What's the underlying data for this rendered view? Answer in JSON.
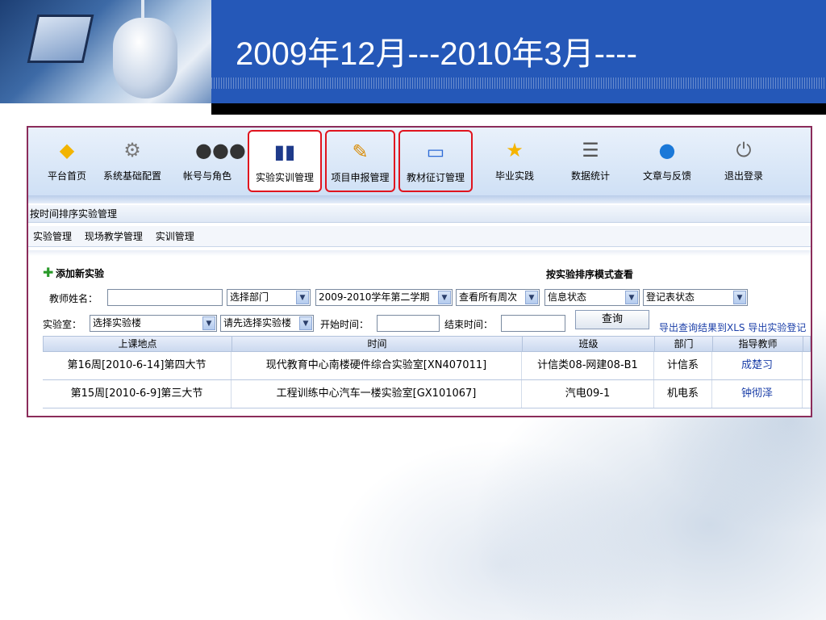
{
  "slide": {
    "title": "2009年12月---2010年3月----"
  },
  "toolbar": {
    "items": [
      {
        "label": "平台首页",
        "icon": "⬦",
        "icon_name": "home-icon",
        "color": "#f2b400"
      },
      {
        "label": "系统基础配置",
        "icon": "⚙",
        "icon_name": "gear-icon",
        "color": "#7a7a7a"
      },
      {
        "label": "帐号与角色",
        "icon": "👥",
        "icon_name": "users-icon",
        "color": "#333333"
      },
      {
        "label": "实验实训管理",
        "icon": "📚",
        "icon_name": "books-icon",
        "color": "#1e3a8a"
      },
      {
        "label": "项目申报管理",
        "icon": "📝",
        "icon_name": "edit-document-icon",
        "color": "#d98a00"
      },
      {
        "label": "教材征订管理",
        "icon": "🖼",
        "icon_name": "screen-icon",
        "color": "#2d6bd6"
      },
      {
        "label": "毕业实践",
        "icon": "★",
        "icon_name": "star-icon",
        "color": "#f5b400"
      },
      {
        "label": "数据统计",
        "icon": "☰",
        "icon_name": "database-icon",
        "color": "#555555"
      },
      {
        "label": "文章与反馈",
        "icon": "💬",
        "icon_name": "chat-bubble-icon",
        "color": "#1a78d8"
      },
      {
        "label": "退出登录",
        "icon": "⏻",
        "icon_name": "power-icon",
        "color": "#666666"
      }
    ]
  },
  "section_title": "按时间排序实验管理",
  "subnav": {
    "items": [
      "实验管理",
      "现场教学管理",
      "实训管理"
    ]
  },
  "actions": {
    "add_new": "添加新实验",
    "view_mode": "按实验排序模式查看"
  },
  "filters": {
    "teacher_label": "教师姓名：",
    "teacher_value": "",
    "department": "选择部门",
    "semester": "2009-2010学年第二学期",
    "weeks": "查看所有周次",
    "info_status": "信息状态",
    "register_status": "登记表状态",
    "lab_label": "实验室：",
    "building": "选择实验楼",
    "building_hint": "请先选择实验楼",
    "start_label": "开始时间：",
    "start_value": "",
    "end_label": "结束时间：",
    "end_value": "",
    "query_button": "查询",
    "export": "导出查询结果到XLS 导出实验登记"
  },
  "table": {
    "columns": [
      "上课地点",
      "时间",
      "班级",
      "部门",
      "指导教师"
    ],
    "rows": [
      [
        "第16周[2010-6-14]第四大节",
        "现代教育中心南楼硬件综合实验室[XN407011]",
        "计信类08-网建08-B1",
        "计信系",
        "成楚习"
      ],
      [
        "第15周[2010-6-9]第三大节",
        "工程训练中心汽车一楼实验室[GX101067]",
        "汽电09-1",
        "机电系",
        "钟彻泽"
      ]
    ]
  },
  "colors": {
    "title_band": "#2558b8",
    "frame_border": "#8b2c5a",
    "highlight": "#e0141e",
    "link": "#1b3fa8"
  }
}
